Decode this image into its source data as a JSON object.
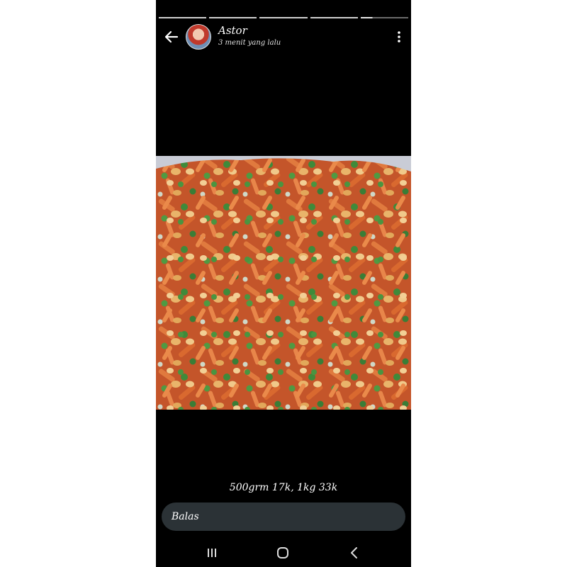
{
  "story": {
    "username": "Astor",
    "time_ago": "3 menit yang lalu",
    "caption": "500grm 17k, 1kg 33k",
    "reply_label": "Balas",
    "segments_total": 5,
    "current_segment_progress": 0.25
  },
  "icons": {
    "back": "back-arrow-icon",
    "menu": "more-vert-icon",
    "recents": "recents-icon",
    "home": "home-icon",
    "nav_back": "nav-back-icon"
  },
  "colors": {
    "background": "#000000",
    "reply_bar": "#2b3236",
    "progress_done": "#cfcfcf"
  }
}
